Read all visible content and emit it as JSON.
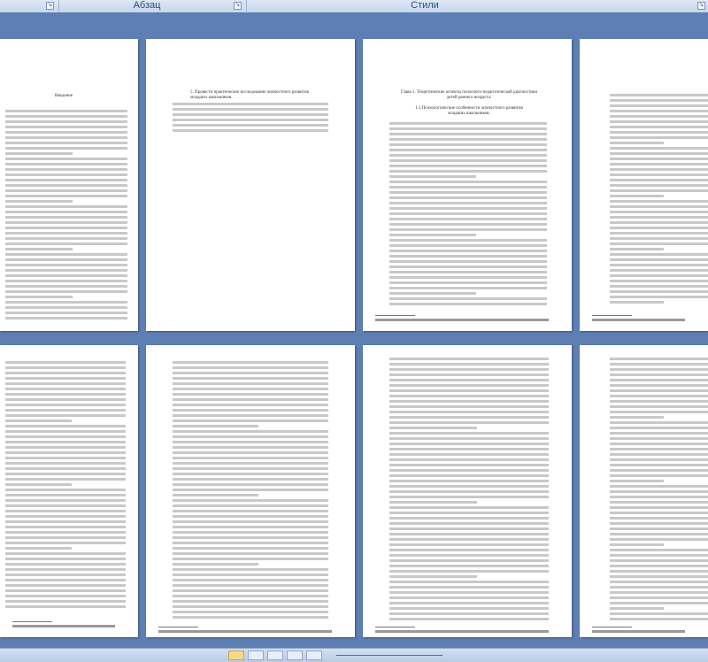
{
  "ribbon": {
    "groups": [
      {
        "label": "Абзац"
      },
      {
        "label": "Стили"
      }
    ],
    "launcher_glyph": "↘"
  },
  "pages": {
    "p1": {
      "heading": "Введение"
    },
    "p2": {
      "heading": "5. Провести практическое исследование личностного развития младших школьников."
    },
    "p3": {
      "heading": "Глава 1. Теоретические аспекты психолого-педагогической диагностики детей раннего возраста."
    },
    "p3_sub": {
      "heading": "1.1 Психологические особенности личностного развития младших школьников."
    },
    "p4": {
      "heading": ""
    }
  },
  "statusbar": {
    "view_buttons": [
      "print-layout",
      "full-screen",
      "web-layout",
      "outline",
      "draft"
    ]
  },
  "colors": {
    "workspace": "#5d7fb4",
    "ribbon": "#dfe8f5",
    "page": "#ffffff"
  }
}
